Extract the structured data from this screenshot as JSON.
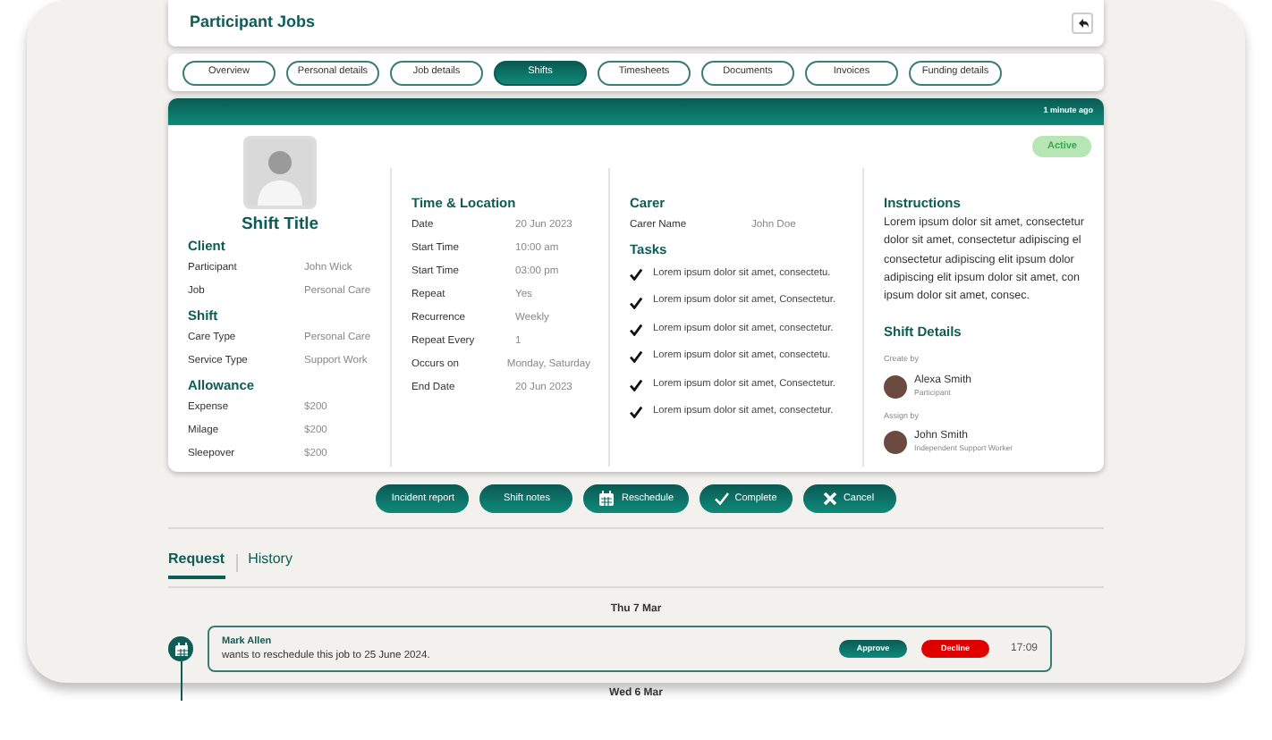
{
  "header": {
    "title": "Participant Jobs"
  },
  "tabs": [
    {
      "label": "Overview",
      "selected": false
    },
    {
      "label": "Personal details",
      "selected": false
    },
    {
      "label": "Job details",
      "selected": false
    },
    {
      "label": "Shifts",
      "selected": true
    },
    {
      "label": "Timesheets",
      "selected": false
    },
    {
      "label": "Documents",
      "selected": false
    },
    {
      "label": "Invoices",
      "selected": false
    },
    {
      "label": "Funding details",
      "selected": false
    }
  ],
  "shift": {
    "updated": "1 minute ago",
    "status": "Active",
    "title": "Shift Title",
    "sections": [
      {
        "heading": "Client",
        "rows": [
          {
            "label": "Participant",
            "value": "John Wick"
          },
          {
            "label": "Job",
            "value": "Personal Care"
          }
        ]
      },
      {
        "heading": "Shift",
        "rows": [
          {
            "label": "Care Type",
            "value": "Personal Care"
          },
          {
            "label": "Service Type",
            "value": "Support Work"
          }
        ]
      },
      {
        "heading": "Allowance",
        "rows": [
          {
            "label": "Expense",
            "value": "$200"
          },
          {
            "label": "Milage",
            "value": "$200"
          },
          {
            "label": "Sleepover",
            "value": "$200"
          }
        ]
      }
    ]
  },
  "time_location": {
    "heading": "Time & Location",
    "rows": [
      {
        "label": "Date",
        "value": "20 Jun 2023"
      },
      {
        "label": "Start Time",
        "value": "10:00 am"
      },
      {
        "label": "Start Time",
        "value": "03:00 pm"
      },
      {
        "label": "Repeat",
        "value": "Yes"
      },
      {
        "label": "Recurrence",
        "value": "Weekly"
      },
      {
        "label": "Repeat Every",
        "value": "1"
      },
      {
        "label": "Occurs on",
        "value": "Monday, Saturday"
      },
      {
        "label": "End Date",
        "value": "20 Jun 2023"
      }
    ]
  },
  "carer": {
    "heading": "Carer",
    "rows": [
      {
        "label": "Carer Name",
        "value": "John Doe"
      }
    ],
    "tasks_heading": "Tasks",
    "tasks": [
      {
        "text": "Lorem ipsum dolor sit amet, consectetu.",
        "checked": true
      },
      {
        "text": "Lorem ipsum dolor sit amet, Consectetur.",
        "checked": true
      },
      {
        "text": "Lorem ipsum dolor sit amet, consectetur.",
        "checked": true
      },
      {
        "text": "Lorem ipsum dolor sit amet, consectetu.",
        "checked": true
      },
      {
        "text": "Lorem ipsum dolor sit amet, Consectetur.",
        "checked": true
      },
      {
        "text": "Lorem ipsum dolor sit amet, consectetur.",
        "checked": true
      }
    ]
  },
  "instructions": {
    "heading": "Instructions",
    "text": "Lorem ipsum dolor sit amet, consectetur dolor sit amet, consectetur adipiscing el consectetur adipiscing elit  ipsum dolor adipiscing elit  ipsum dolor sit amet, con ipsum dolor sit amet, consec.",
    "details_heading": "Shift Details",
    "people": [
      {
        "caption": "Create by",
        "name": "Alexa Smith",
        "role": "Participant"
      },
      {
        "caption": "Assign by",
        "name": "John Smith",
        "role": "Independent Support Worker"
      }
    ]
  },
  "actions": [
    {
      "label": "Incident report",
      "kind": "plain"
    },
    {
      "label": "Shift notes",
      "kind": "plain"
    },
    {
      "label": "Reschedule",
      "kind": "calendar"
    },
    {
      "label": "Complete",
      "kind": "check"
    },
    {
      "label": "Cancel",
      "kind": "close"
    }
  ],
  "request_tabs": [
    {
      "label": "Request",
      "selected": true
    },
    {
      "label": "History",
      "selected": false
    }
  ],
  "timeline": [
    {
      "date": "Thu 7 Mar",
      "requests": [
        {
          "name": "Mark Allen",
          "message": "wants to reschedule this job to 25 June 2024.",
          "approve": "Approve",
          "decline": "Decline",
          "time": "17:09"
        }
      ]
    },
    {
      "date": "Wed 6 Mar"
    }
  ]
}
